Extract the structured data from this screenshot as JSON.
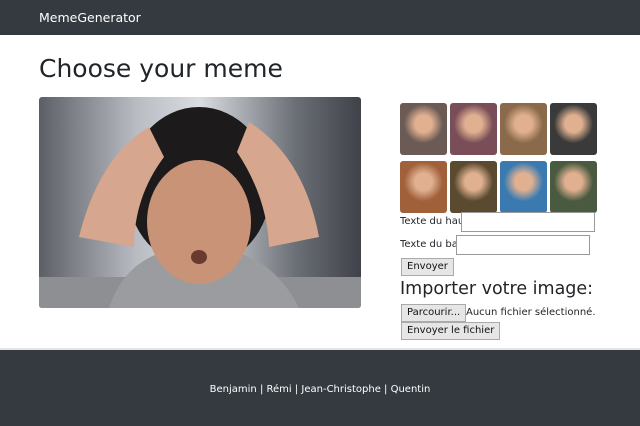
{
  "nav": {
    "brand": "MemeGenerator"
  },
  "page_title": "Choose your meme",
  "thumbnails": [
    "#6b5a55",
    "#7a4e58",
    "#8a6a4a",
    "#3a3a3a",
    "#a0603a",
    "#5a4a30",
    "#3a7ab0",
    "#4a5a40"
  ],
  "form": {
    "top_label": "Texte du haut",
    "top_value": "",
    "bottom_label": "Texte du bas",
    "bottom_value": "",
    "submit": "Envoyer"
  },
  "upload": {
    "title": "Importer votre image:",
    "browse": "Parcourir...",
    "no_file": "Aucun fichier sélectionné.",
    "send": "Envoyer le fichier"
  },
  "footer": "Benjamin | Rémi | Jean-Christophe | Quentin"
}
